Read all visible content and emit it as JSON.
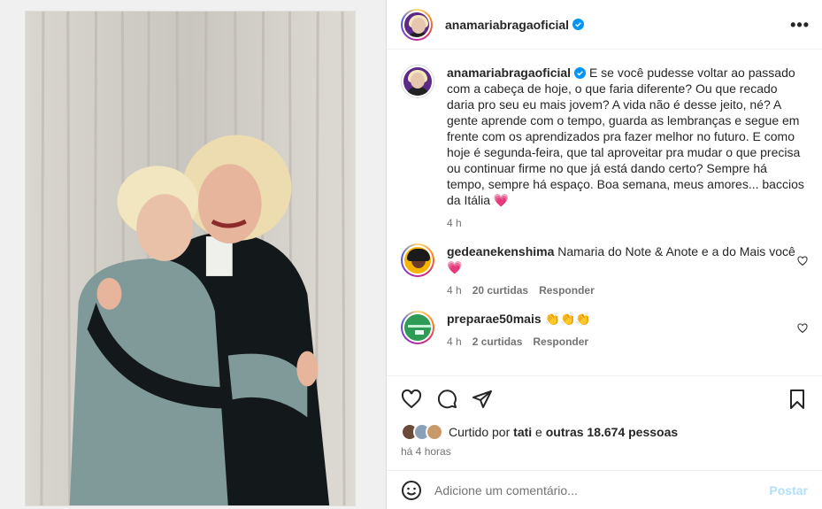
{
  "header": {
    "username": "anamariabragaoficial",
    "more_label": "•••"
  },
  "caption": {
    "username": "anamariabragaoficial",
    "text": "E se você pudesse voltar ao passado com a cabeça de hoje, o que faria diferente? Ou que recado daria pro seu eu mais jovem? A vida não é desse jeito, né? A gente aprende com o tempo, guarda as lembranças e segue em frente com os aprendizados pra fazer melhor no futuro. E como hoje é segunda-feira, que tal aproveitar pra mudar o que precisa ou continuar firme no que já está dando certo? Sempre há tempo, sempre há espaço. Boa semana, meus amores... baccios da Itália 💗",
    "time": "4 h"
  },
  "comments": [
    {
      "username": "gedeanekenshima",
      "text": "Namaria do Note & Anote e a do Mais você 💗",
      "time": "4 h",
      "likes": "20 curtidas",
      "reply": "Responder"
    },
    {
      "username": "preparae50mais",
      "text": "👏👏👏",
      "time": "4 h",
      "likes": "2 curtidas",
      "reply": "Responder"
    }
  ],
  "likes": {
    "prefix": "Curtido por",
    "user": "tati",
    "connector": "e",
    "others": "outras 18.674 pessoas"
  },
  "post_time": "há 4 horas",
  "add_comment": {
    "placeholder": "Adicione um comentário...",
    "post_label": "Postar"
  },
  "colors": {
    "verified": "#0095f6",
    "heart": "#ff3040",
    "post_disabled": "#b2dffc",
    "muted": "#737373"
  }
}
